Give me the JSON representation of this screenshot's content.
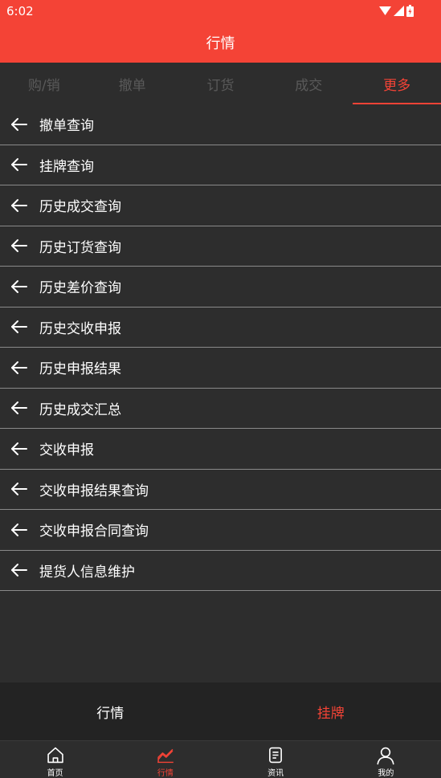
{
  "status_bar": {
    "time": "6:02"
  },
  "header": {
    "title": "行情"
  },
  "tabs": [
    {
      "label": "购/销",
      "active": false
    },
    {
      "label": "撤单",
      "active": false
    },
    {
      "label": "订货",
      "active": false
    },
    {
      "label": "成交",
      "active": false
    },
    {
      "label": "更多",
      "active": true
    }
  ],
  "menu_items": [
    {
      "label": "撤单查询"
    },
    {
      "label": "挂牌查询"
    },
    {
      "label": "历史成交查询"
    },
    {
      "label": "历史订货查询"
    },
    {
      "label": "历史差价查询"
    },
    {
      "label": "历史交收申报"
    },
    {
      "label": "历史申报结果"
    },
    {
      "label": "历史成交汇总"
    },
    {
      "label": "交收申报"
    },
    {
      "label": "交收申报结果查询"
    },
    {
      "label": "交收申报合同查询"
    },
    {
      "label": "提货人信息维护"
    }
  ],
  "sub_tabs": [
    {
      "label": "行情",
      "active": false
    },
    {
      "label": "挂牌",
      "active": true
    }
  ],
  "bottom_nav": [
    {
      "label": "首页",
      "icon": "home-icon",
      "active": false
    },
    {
      "label": "行情",
      "icon": "chart-icon",
      "active": true
    },
    {
      "label": "资讯",
      "icon": "news-icon",
      "active": false
    },
    {
      "label": "我的",
      "icon": "profile-icon",
      "active": false
    }
  ],
  "colors": {
    "accent": "#f44336",
    "background": "#2d2d2d",
    "divider": "#8a8a8a"
  }
}
